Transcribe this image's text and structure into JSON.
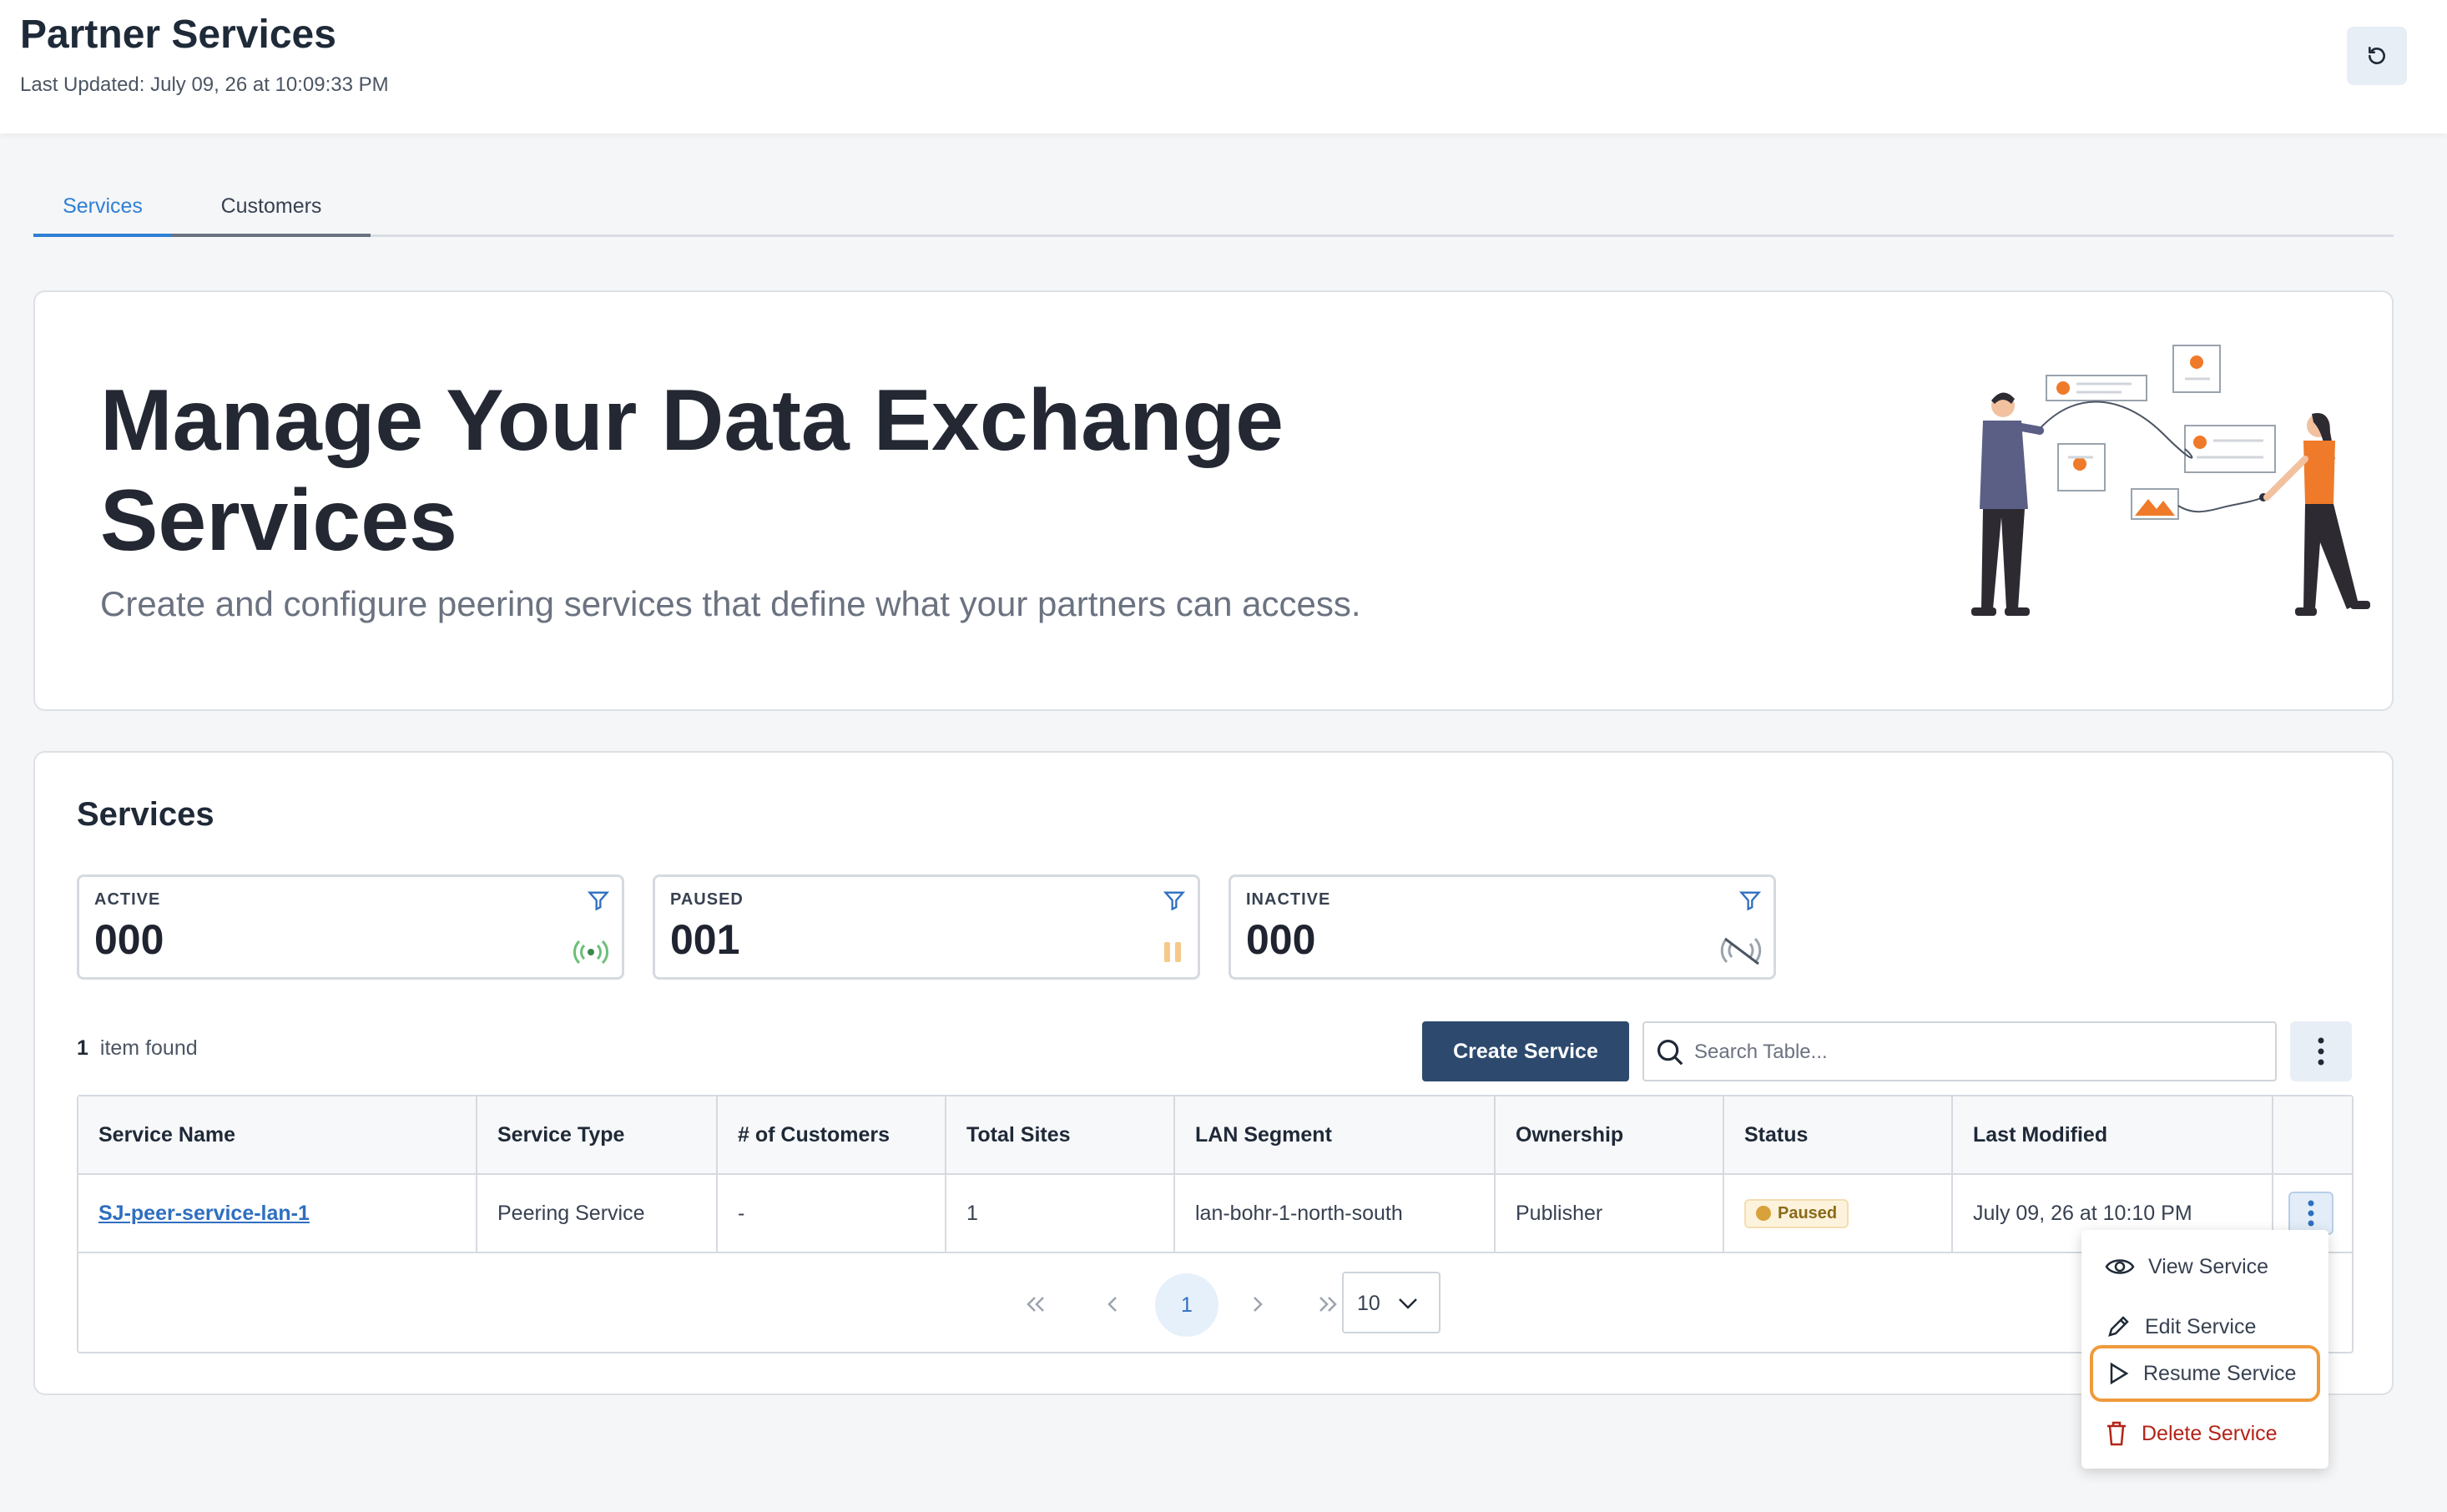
{
  "header": {
    "title": "Partner Services",
    "last_updated": "Last Updated: July 09, 26 at 10:09:33 PM",
    "refresh_icon": "refresh-icon"
  },
  "tabs": [
    {
      "label": "Services",
      "active": true
    },
    {
      "label": "Customers",
      "active": false
    }
  ],
  "hero": {
    "title": "Manage Your Data Exchange Services",
    "subtitle": "Create and configure peering services that define what your partners can access."
  },
  "services": {
    "heading": "Services",
    "stats": [
      {
        "label": "ACTIVE",
        "value": "000",
        "icon": "signal-icon",
        "color": "#6cbf7a"
      },
      {
        "label": "PAUSED",
        "value": "001",
        "icon": "pause-icon",
        "color": "#f6c98a"
      },
      {
        "label": "INACTIVE",
        "value": "000",
        "icon": "signal-off-icon",
        "color": "#9aa3ad"
      }
    ],
    "items_count": "1",
    "items_label": "item found",
    "create_button": "Create Service",
    "search_placeholder": "Search Table...",
    "columns": [
      "Service Name",
      "Service Type",
      "# of Customers",
      "Total Sites",
      "LAN Segment",
      "Ownership",
      "Status",
      "Last Modified"
    ],
    "rows": [
      {
        "service_name": "SJ-peer-service-lan-1",
        "service_type": "Peering Service",
        "customers": "-",
        "total_sites": "1",
        "lan_segment": "lan-bohr-1-north-south",
        "ownership": "Publisher",
        "status": "Paused",
        "last_modified": "July 09, 26 at 10:10 PM"
      }
    ],
    "pagination": {
      "current_page": "1",
      "page_size": "10"
    }
  },
  "row_menu": {
    "items": [
      {
        "label": "View Service",
        "icon": "eye-icon"
      },
      {
        "label": "Edit Service",
        "icon": "pencil-icon"
      },
      {
        "label": "Resume Service",
        "icon": "play-icon"
      },
      {
        "label": "Delete Service",
        "icon": "trash-icon"
      }
    ]
  },
  "colors": {
    "primary_button": "#2d4a6e",
    "accent": "#2f7fd6",
    "highlight_border": "#ef9a3c",
    "danger": "#b42318"
  }
}
